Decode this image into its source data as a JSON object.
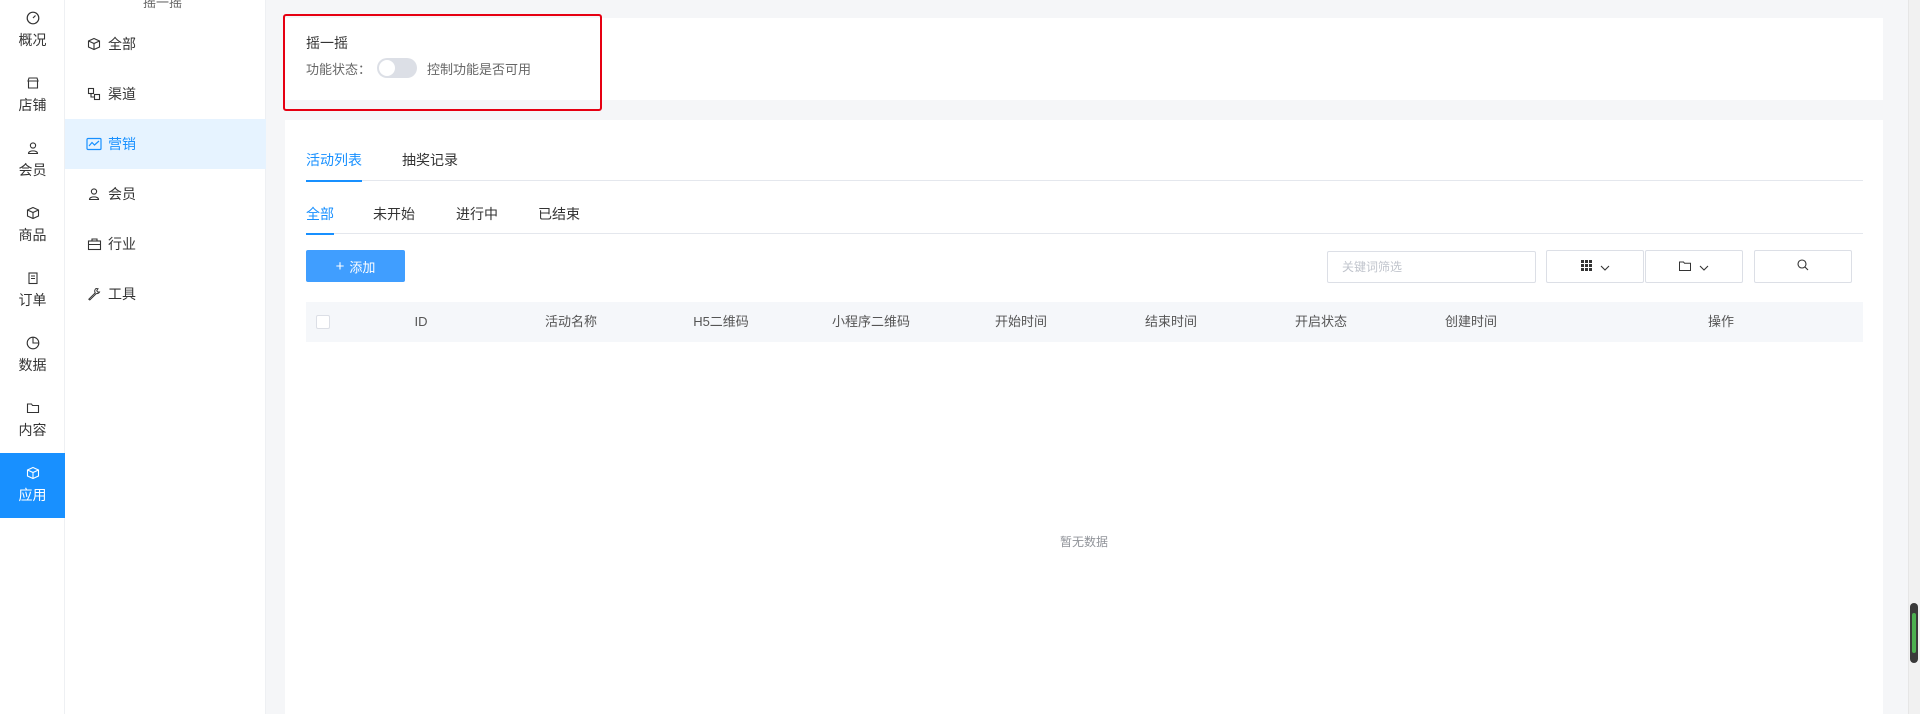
{
  "rail": {
    "items": [
      {
        "label": "概况",
        "icon": "dashboard-icon"
      },
      {
        "label": "店铺",
        "icon": "store-icon"
      },
      {
        "label": "会员",
        "icon": "user-icon"
      },
      {
        "label": "商品",
        "icon": "box-icon"
      },
      {
        "label": "订单",
        "icon": "order-icon"
      },
      {
        "label": "数据",
        "icon": "chart-icon"
      },
      {
        "label": "内容",
        "icon": "folder-icon"
      },
      {
        "label": "应用",
        "icon": "app-icon"
      }
    ],
    "active_index": 7
  },
  "submenu": {
    "top_text": "摇一摇",
    "items": [
      {
        "label": "全部",
        "icon": "cube-icon"
      },
      {
        "label": "渠道",
        "icon": "channel-icon"
      },
      {
        "label": "营销",
        "icon": "marketing-icon"
      },
      {
        "label": "会员",
        "icon": "member-icon"
      },
      {
        "label": "行业",
        "icon": "industry-icon"
      },
      {
        "label": "工具",
        "icon": "wrench-icon"
      }
    ],
    "active_index": 2
  },
  "feature": {
    "title": "摇一摇",
    "status_label": "功能状态：",
    "toggle_on": false,
    "status_hint": "控制功能是否可用"
  },
  "tabs": {
    "primary": [
      {
        "label": "活动列表"
      },
      {
        "label": "抽奖记录"
      }
    ],
    "primary_active": 0,
    "secondary": [
      {
        "label": "全部"
      },
      {
        "label": "未开始"
      },
      {
        "label": "进行中"
      },
      {
        "label": "已结束"
      }
    ],
    "secondary_active": 0
  },
  "toolbar": {
    "add_label": "添加",
    "search_placeholder": "关键词筛选"
  },
  "table": {
    "columns": [
      "ID",
      "活动名称",
      "H5二维码",
      "小程序二维码",
      "开始时间",
      "结束时间",
      "开启状态",
      "创建时间",
      "操作"
    ],
    "empty_text": "暂无数据"
  },
  "colors": {
    "accent": "#1890ff",
    "highlight_border": "#e60012"
  }
}
